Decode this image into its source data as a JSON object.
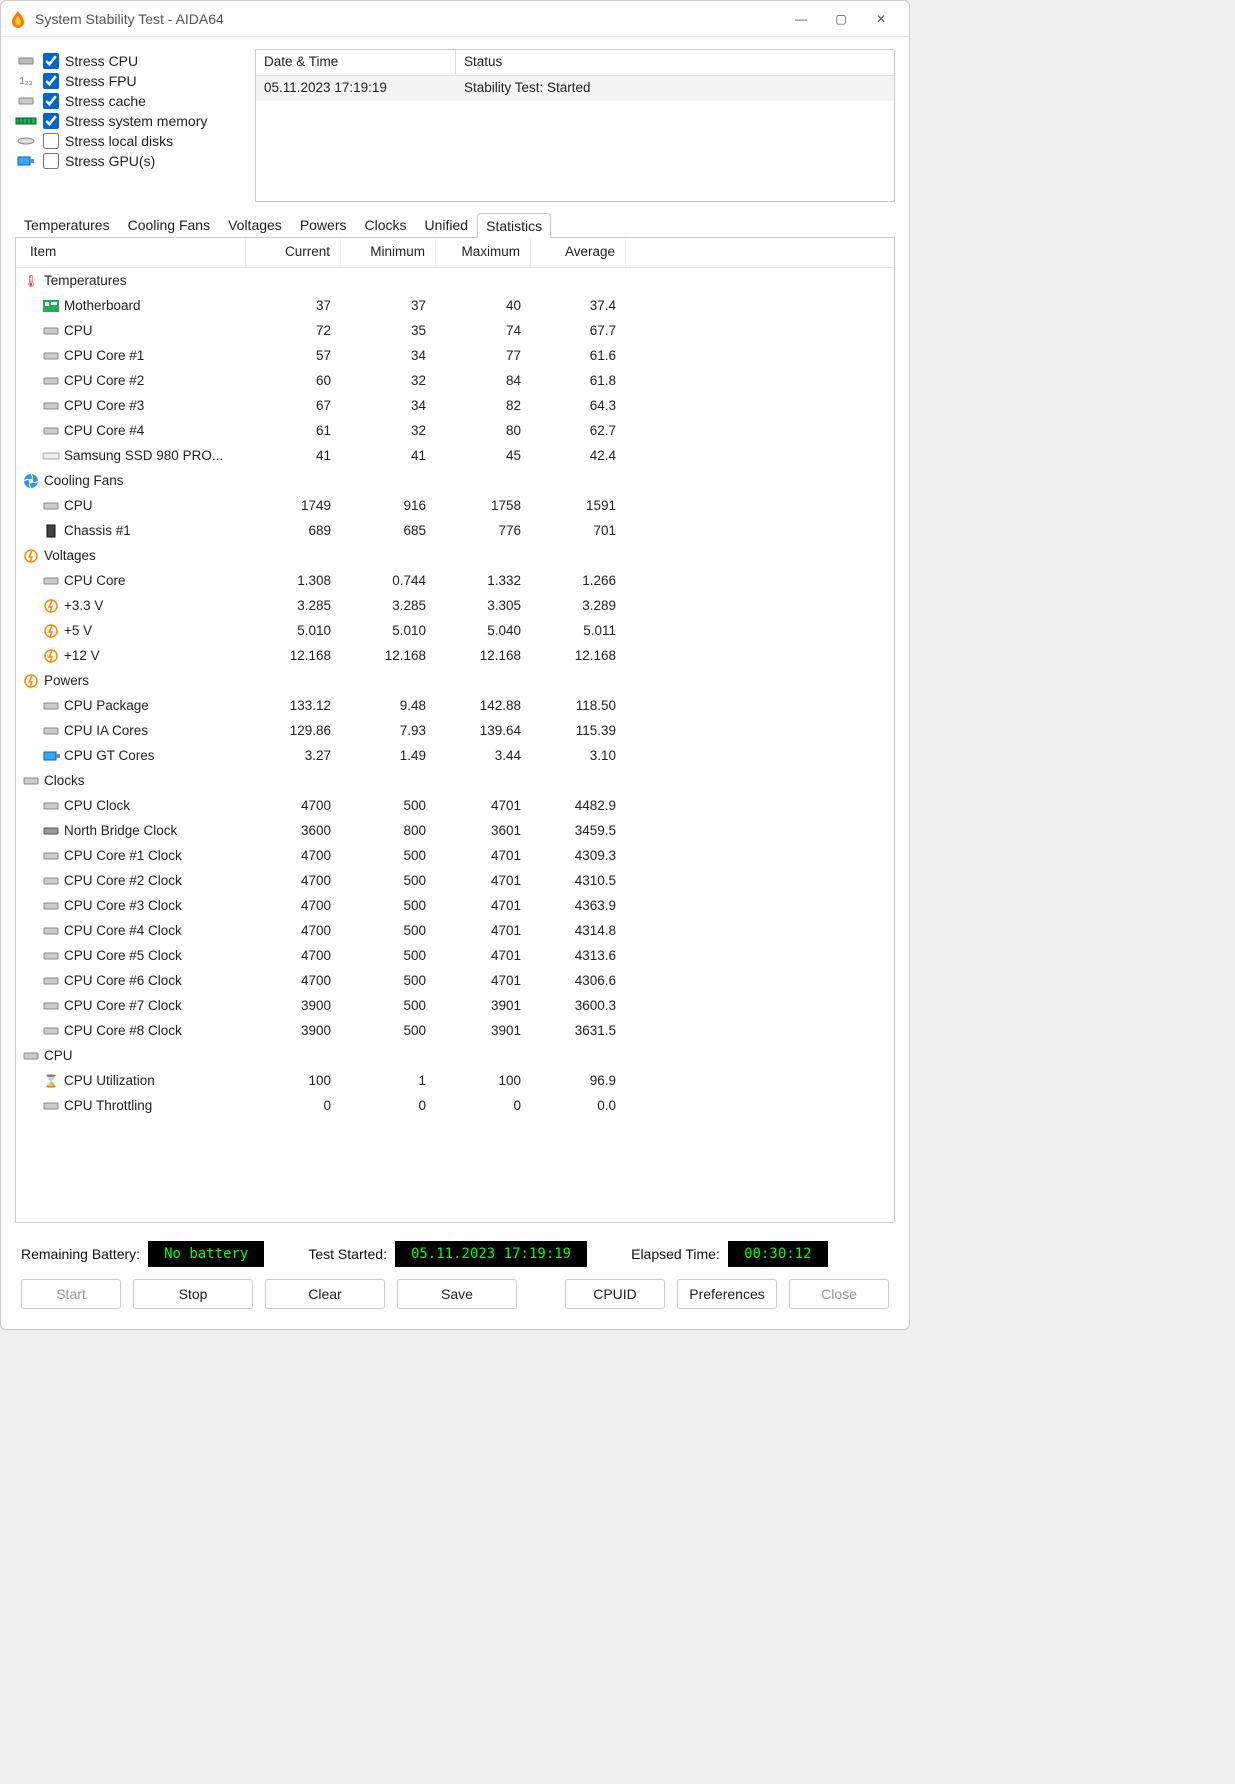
{
  "window": {
    "title": "System Stability Test - AIDA64"
  },
  "stress": [
    {
      "label": "Stress CPU",
      "checked": true,
      "i": "cpu"
    },
    {
      "label": "Stress FPU",
      "checked": true,
      "i": "fpu"
    },
    {
      "label": "Stress cache",
      "checked": true,
      "i": "cache"
    },
    {
      "label": "Stress system memory",
      "checked": true,
      "i": "mem"
    },
    {
      "label": "Stress local disks",
      "checked": false,
      "i": "disk"
    },
    {
      "label": "Stress GPU(s)",
      "checked": false,
      "i": "gpu"
    }
  ],
  "log": {
    "h1": "Date & Time",
    "h2": "Status",
    "rows": [
      {
        "dt": "05.11.2023 17:19:19",
        "st": "Stability Test: Started"
      },
      {
        "dt": "",
        "st": ""
      },
      {
        "dt": "",
        "st": ""
      },
      {
        "dt": "",
        "st": ""
      },
      {
        "dt": "",
        "st": ""
      }
    ]
  },
  "tabs": [
    "Temperatures",
    "Cooling Fans",
    "Voltages",
    "Powers",
    "Clocks",
    "Unified",
    "Statistics"
  ],
  "activeTab": 6,
  "stats": {
    "head": [
      "Item",
      "Current",
      "Minimum",
      "Maximum",
      "Average"
    ],
    "groups": [
      {
        "label": "Temperatures",
        "icon": "therm",
        "rows": [
          {
            "icon": "mb",
            "label": "Motherboard",
            "cur": "37",
            "min": "37",
            "max": "40",
            "avg": "37.4"
          },
          {
            "icon": "chip",
            "label": "CPU",
            "cur": "72",
            "min": "35",
            "max": "74",
            "avg": "67.7"
          },
          {
            "icon": "chip",
            "label": "CPU Core #1",
            "cur": "57",
            "min": "34",
            "max": "77",
            "avg": "61.6"
          },
          {
            "icon": "chip",
            "label": "CPU Core #2",
            "cur": "60",
            "min": "32",
            "max": "84",
            "avg": "61.8"
          },
          {
            "icon": "chip",
            "label": "CPU Core #3",
            "cur": "67",
            "min": "34",
            "max": "82",
            "avg": "64.3"
          },
          {
            "icon": "chip",
            "label": "CPU Core #4",
            "cur": "61",
            "min": "32",
            "max": "80",
            "avg": "62.7"
          },
          {
            "icon": "ssd",
            "label": "Samsung SSD 980 PRO...",
            "cur": "41",
            "min": "41",
            "max": "45",
            "avg": "42.4"
          }
        ]
      },
      {
        "label": "Cooling Fans",
        "icon": "fan",
        "rows": [
          {
            "icon": "chip",
            "label": "CPU",
            "cur": "1749",
            "min": "916",
            "max": "1758",
            "avg": "1591"
          },
          {
            "icon": "case",
            "label": "Chassis #1",
            "cur": "689",
            "min": "685",
            "max": "776",
            "avg": "701"
          }
        ]
      },
      {
        "label": "Voltages",
        "icon": "volt",
        "rows": [
          {
            "icon": "chip",
            "label": "CPU Core",
            "cur": "1.308",
            "min": "0.744",
            "max": "1.332",
            "avg": "1.266"
          },
          {
            "icon": "volt",
            "label": "+3.3 V",
            "cur": "3.285",
            "min": "3.285",
            "max": "3.305",
            "avg": "3.289"
          },
          {
            "icon": "volt",
            "label": "+5 V",
            "cur": "5.010",
            "min": "5.010",
            "max": "5.040",
            "avg": "5.011"
          },
          {
            "icon": "volt",
            "label": "+12 V",
            "cur": "12.168",
            "min": "12.168",
            "max": "12.168",
            "avg": "12.168"
          }
        ]
      },
      {
        "label": "Powers",
        "icon": "volt",
        "rows": [
          {
            "icon": "chip",
            "label": "CPU Package",
            "cur": "133.12",
            "min": "9.48",
            "max": "142.88",
            "avg": "118.50"
          },
          {
            "icon": "chip",
            "label": "CPU IA Cores",
            "cur": "129.86",
            "min": "7.93",
            "max": "139.64",
            "avg": "115.39"
          },
          {
            "icon": "gpu",
            "label": "CPU GT Cores",
            "cur": "3.27",
            "min": "1.49",
            "max": "3.44",
            "avg": "3.10"
          }
        ]
      },
      {
        "label": "Clocks",
        "icon": "chip",
        "rows": [
          {
            "icon": "chip",
            "label": "CPU Clock",
            "cur": "4700",
            "min": "500",
            "max": "4701",
            "avg": "4482.9"
          },
          {
            "icon": "chip2",
            "label": "North Bridge Clock",
            "cur": "3600",
            "min": "800",
            "max": "3601",
            "avg": "3459.5"
          },
          {
            "icon": "chip",
            "label": "CPU Core #1 Clock",
            "cur": "4700",
            "min": "500",
            "max": "4701",
            "avg": "4309.3"
          },
          {
            "icon": "chip",
            "label": "CPU Core #2 Clock",
            "cur": "4700",
            "min": "500",
            "max": "4701",
            "avg": "4310.5"
          },
          {
            "icon": "chip",
            "label": "CPU Core #3 Clock",
            "cur": "4700",
            "min": "500",
            "max": "4701",
            "avg": "4363.9"
          },
          {
            "icon": "chip",
            "label": "CPU Core #4 Clock",
            "cur": "4700",
            "min": "500",
            "max": "4701",
            "avg": "4314.8"
          },
          {
            "icon": "chip",
            "label": "CPU Core #5 Clock",
            "cur": "4700",
            "min": "500",
            "max": "4701",
            "avg": "4313.6"
          },
          {
            "icon": "chip",
            "label": "CPU Core #6 Clock",
            "cur": "4700",
            "min": "500",
            "max": "4701",
            "avg": "4306.6"
          },
          {
            "icon": "chip",
            "label": "CPU Core #7 Clock",
            "cur": "3900",
            "min": "500",
            "max": "3901",
            "avg": "3600.3"
          },
          {
            "icon": "chip",
            "label": "CPU Core #8 Clock",
            "cur": "3900",
            "min": "500",
            "max": "3901",
            "avg": "3631.5"
          }
        ]
      },
      {
        "label": "CPU",
        "icon": "chip",
        "rows": [
          {
            "icon": "hg",
            "label": "CPU Utilization",
            "cur": "100",
            "min": "1",
            "max": "100",
            "avg": "96.9"
          },
          {
            "icon": "chip",
            "label": "CPU Throttling",
            "cur": "0",
            "min": "0",
            "max": "0",
            "avg": "0.0"
          }
        ]
      }
    ]
  },
  "status": {
    "batteryLabel": "Remaining Battery:",
    "battery": "No battery",
    "startedLabel": "Test Started:",
    "started": "05.11.2023 17:19:19",
    "elapsedLabel": "Elapsed Time:",
    "elapsed": "00:30:12"
  },
  "buttons": {
    "start": "Start",
    "stop": "Stop",
    "clear": "Clear",
    "save": "Save",
    "cpuid": "CPUID",
    "prefs": "Preferences",
    "close": "Close"
  }
}
